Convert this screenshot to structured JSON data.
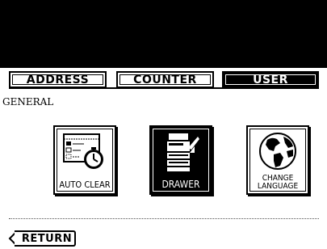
{
  "tabs": [
    {
      "label": "ADDRESS",
      "active": false
    },
    {
      "label": "COUNTER",
      "active": false
    },
    {
      "label": "USER",
      "active": true
    }
  ],
  "section": {
    "label": "GENERAL"
  },
  "tiles": [
    {
      "label": "AUTO CLEAR",
      "icon": "auto-clear-timer-icon"
    },
    {
      "label": "DRAWER",
      "icon": "copier-drawer-icon",
      "selected": true
    },
    {
      "label_line1": "CHANGE",
      "label_line2": "LANGUAGE",
      "icon": "globe-icon"
    }
  ],
  "footer": {
    "return_label": "RETURN"
  },
  "colors": {
    "background": "#ffffff",
    "foreground": "#000000"
  }
}
